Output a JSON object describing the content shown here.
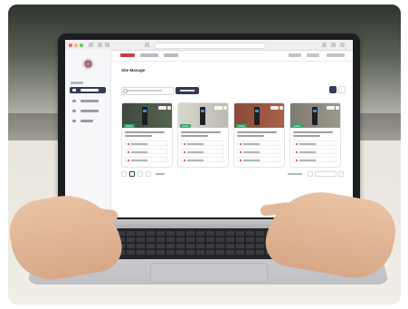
{
  "page": {
    "title": "Site Manage"
  },
  "colors": {
    "brand_navy": "#343a5a",
    "accent_red": "#c94040",
    "badge_green": "#2fa56b",
    "laptop_bezel": "#1c1d20"
  },
  "cards": [
    {
      "photo": "charger-on-dark-wall",
      "badge": "Active"
    },
    {
      "photo": "charger-on-light-wall",
      "badge": "Active"
    },
    {
      "photo": "charger-on-brick-wall",
      "badge": "Active"
    },
    {
      "photo": "charger-on-stone-wall",
      "badge": "Active"
    }
  ],
  "icons": {
    "logo": "company-logo-icon",
    "search": "search-icon",
    "grid_view": "grid-view-icon",
    "list_view": "list-view-icon"
  }
}
